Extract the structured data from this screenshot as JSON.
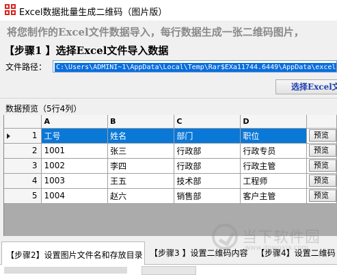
{
  "window": {
    "title": "Excel数据批量生成二维码（图片版）"
  },
  "intro": {
    "text": "将您制作的Excel文件数据导入，每行数据生成一张二维码图片，"
  },
  "step1": {
    "heading": "【步骤1 】选择Excel文件导入数据",
    "path_label": "文件路径：",
    "path_value": "C:\\Users\\ADMINI~1\\AppData\\Local\\Temp\\Rar$EXa11744.6449\\AppData\\excel",
    "choose_button": "选择Excel文"
  },
  "preview": {
    "label": "数据预览（5行4列）",
    "column_letters": [
      "A",
      "B",
      "C",
      "D"
    ],
    "rows": [
      {
        "num": "1",
        "cells": [
          "工号",
          "姓名",
          "部门",
          "职位"
        ],
        "button": "预览",
        "selected": true
      },
      {
        "num": "2",
        "cells": [
          "1001",
          "张三",
          "行政部",
          "行政专员"
        ],
        "button": "预览",
        "selected": false
      },
      {
        "num": "3",
        "cells": [
          "1002",
          "李四",
          "行政部",
          "行政主管"
        ],
        "button": "预览",
        "selected": false
      },
      {
        "num": "4",
        "cells": [
          "1003",
          "王五",
          "技术部",
          "工程师"
        ],
        "button": "预览",
        "selected": false
      },
      {
        "num": "5",
        "cells": [
          "1004",
          "赵六",
          "销售部",
          "客户主管"
        ],
        "button": "预览",
        "selected": false
      }
    ]
  },
  "tabs": [
    {
      "label": "【步骤2】设置图片文件名和存放目录",
      "active": true
    },
    {
      "label": "【步骤3 】设置二维码内容",
      "active": false
    },
    {
      "label": "【步骤4】设置二维码",
      "active": false
    }
  ],
  "watermark": {
    "text": "当下软件园",
    "url": "www.downxia.com"
  },
  "colors": {
    "selection": "#0a78d7",
    "title_icon": "#d9231b",
    "choose_button_text": "#1f3fb0"
  }
}
